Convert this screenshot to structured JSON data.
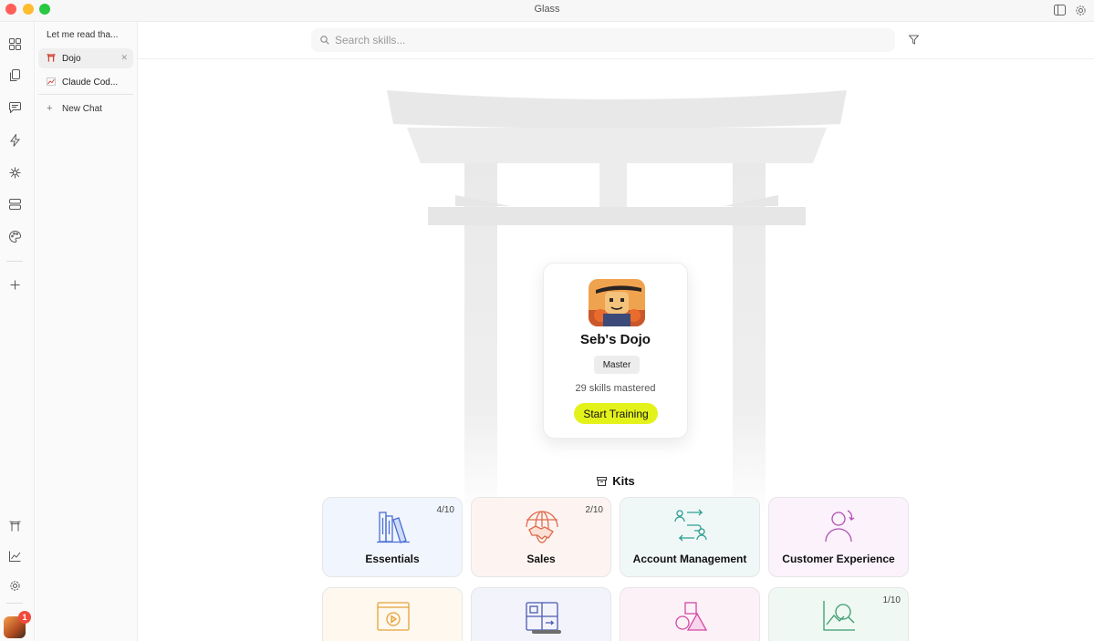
{
  "window": {
    "title": "Glass"
  },
  "sidebar_rail": {
    "notification_count": "1"
  },
  "chat_panel": {
    "heading": "Let me read tha...",
    "items": [
      {
        "label": "Dojo",
        "icon": "torii-gate-icon",
        "active": true
      },
      {
        "label": "Claude Cod...",
        "icon": "chart-emoji-icon",
        "active": false
      }
    ],
    "new_chat_label": "New Chat"
  },
  "search": {
    "placeholder": "Search skills..."
  },
  "profile": {
    "name": "Seb's Dojo",
    "rank": "Master",
    "skills_text": "29 skills mastered",
    "cta_label": "Start Training"
  },
  "kits": {
    "title": "Kits",
    "items": [
      {
        "label": "Essentials",
        "progress": "4/10",
        "icon": "books-icon",
        "color": "#4a6fd1",
        "bg": "#f1f5fe"
      },
      {
        "label": "Sales",
        "progress": "2/10",
        "icon": "handshake-globe-icon",
        "color": "#e06a4a",
        "bg": "#fdf4f1"
      },
      {
        "label": "Account Management",
        "progress": "",
        "icon": "people-exchange-icon",
        "color": "#2f9e93",
        "bg": "#f0f8f7"
      },
      {
        "label": "Customer Experience",
        "progress": "",
        "icon": "person-refresh-icon",
        "color": "#b14fb5",
        "bg": "#fbf2fb"
      },
      {
        "label": "",
        "progress": "",
        "icon": "video-play-icon",
        "color": "#e5a23a",
        "bg": "#fef8ee"
      },
      {
        "label": "",
        "progress": "",
        "icon": "grid-arrows-icon",
        "color": "#4a5ab0",
        "bg": "#f3f3fc"
      },
      {
        "label": "",
        "progress": "",
        "icon": "shapes-icon",
        "color": "#d34aa4",
        "bg": "#fdf1f8"
      },
      {
        "label": "",
        "progress": "1/10",
        "icon": "chart-magnify-icon",
        "color": "#3a9b6d",
        "bg": "#f0f8f3"
      }
    ]
  },
  "colors": {
    "accent": "#e4f21c"
  }
}
